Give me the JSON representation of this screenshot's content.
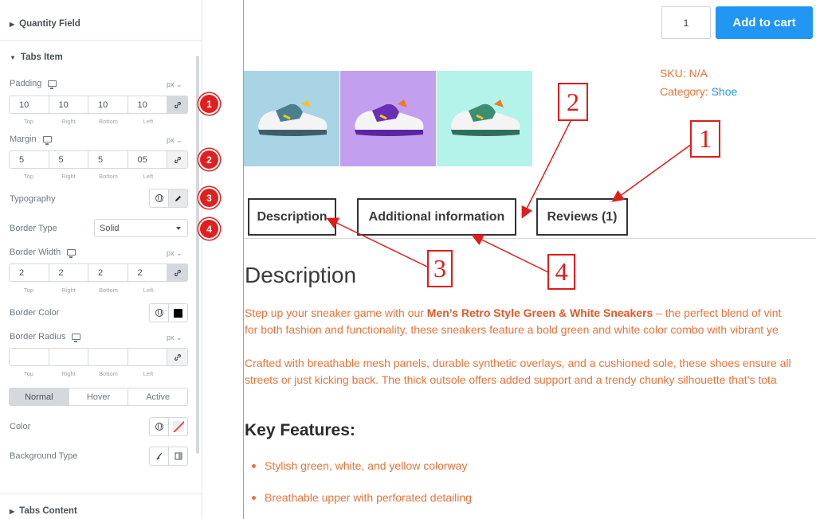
{
  "panel": {
    "quantity_field": "Quantity Field",
    "tabs_item": "Tabs Item",
    "tabs_content": "Tabs Content",
    "padding": {
      "label": "Padding",
      "unit": "px",
      "top": "10",
      "right": "10",
      "bottom": "10",
      "left": "10"
    },
    "margin": {
      "label": "Margin",
      "unit": "px",
      "top": "5",
      "right": "5",
      "bottom": "5",
      "left": "05"
    },
    "dim_labels": {
      "top": "Top",
      "right": "Right",
      "bottom": "Bottom",
      "left": "Left"
    },
    "typography": "Typography",
    "border_type": {
      "label": "Border Type",
      "value": "Solid"
    },
    "border_width": {
      "label": "Border Width",
      "unit": "px",
      "top": "2",
      "right": "2",
      "bottom": "2",
      "left": "2"
    },
    "border_color": "Border Color",
    "border_radius": {
      "label": "Border Radius",
      "unit": "px",
      "top": "",
      "right": "",
      "bottom": "",
      "left": ""
    },
    "states": [
      "Normal",
      "Hover",
      "Active"
    ],
    "color": "Color",
    "background_type": "Background Type",
    "markers": [
      "1",
      "2",
      "3",
      "4"
    ]
  },
  "preview": {
    "qty_value": "1",
    "add_to_cart": "Add to cart",
    "sku_label": "SKU:",
    "sku_value": "N/A",
    "category_label": "Category:",
    "category_value": "Shoe",
    "thumb_colors": [
      "#a8d4e6",
      "#c39ff0",
      "#b4f3ea"
    ],
    "tabs": {
      "description": "Description",
      "additional": "Additional information",
      "reviews": "Reviews (1)"
    },
    "desc_title": "Description",
    "para1_line1_pre": "Step up your sneaker game with our ",
    "para1_line1_bold": "Men’s Retro Style Green & White Sneakers",
    "para1_line1_post": " – the perfect blend of vint",
    "para1_line2": "for both fashion and functionality, these sneakers feature a bold green and white color combo with vibrant ye",
    "para2_line1": "Crafted with breathable mesh panels, durable synthetic overlays, and a cushioned sole, these shoes ensure all",
    "para2_line2": "streets or just kicking back. The thick outsole offers added support and a trendy chunky silhouette that’s tota",
    "key_features": "Key Features:",
    "features": [
      "Stylish green, white, and yellow colorway",
      "Breathable upper with perforated detailing"
    ],
    "callouts": [
      "1",
      "2",
      "3",
      "4"
    ]
  },
  "colors": {
    "accent": "#2196f3",
    "annotation": "#e01c1c",
    "text_orange": "#e8743b"
  }
}
